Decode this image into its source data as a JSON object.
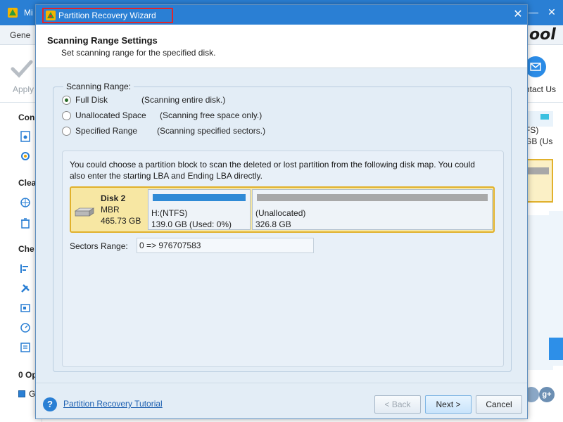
{
  "background_app": {
    "title_text": "Mi",
    "menu": {
      "general_label": "Gene"
    },
    "brand_text": "ool",
    "toolbar": {
      "apply_label": "Apply",
      "contact_label": "ntact Us"
    },
    "sidebar": {
      "section_1": "Con",
      "section_2": "Clea",
      "section_3": "Che",
      "section_4": "0 Op",
      "ops_item": "G"
    },
    "right_panel": {
      "fs_text": "FS)",
      "gb_text": "GB (Us"
    },
    "social": {
      "google_label": "g+"
    }
  },
  "dialog": {
    "title": "Partition Recovery Wizard",
    "close_glyph": "✕",
    "header": {
      "title": "Scanning Range Settings",
      "subtitle": "Set scanning range for the specified disk."
    },
    "scanning_range": {
      "legend": "Scanning Range:",
      "options": [
        {
          "label": "Full Disk",
          "description": "(Scanning entire disk.)",
          "checked": true
        },
        {
          "label": "Unallocated Space",
          "description": "(Scanning free space only.)",
          "checked": false
        },
        {
          "label": "Specified Range",
          "description": "(Scanning specified sectors.)",
          "checked": false
        }
      ]
    },
    "disk_panel": {
      "instructions": "You could choose a partition block to scan the deleted or lost partition from the following disk map. You could also enter the starting LBA and Ending LBA directly.",
      "disk": {
        "name": "Disk 2",
        "type": "MBR",
        "size": "465.73 GB"
      },
      "partitions": [
        {
          "name": "H:(NTFS)",
          "size": "139.0 GB (Used: 0%)",
          "bar_color": "#2f8ad6",
          "used_fraction": 0.0
        },
        {
          "name": "(Unallocated)",
          "size": "326.8 GB",
          "bar_color": "#a8a8a8"
        }
      ],
      "sectors_label": "Sectors Range:",
      "sectors_value": "0 => 976707583"
    },
    "footer": {
      "help_glyph": "?",
      "tutorial_link": "Partition Recovery Tutorial",
      "back_label": "< Back",
      "next_label": "Next >",
      "cancel_label": "Cancel"
    }
  },
  "colors": {
    "title_bar": "#2a7fd4",
    "highlight_frame": "#e0262c",
    "disk_selected_fill": "#f7e7a3",
    "disk_selected_border": "#e1b12c"
  }
}
